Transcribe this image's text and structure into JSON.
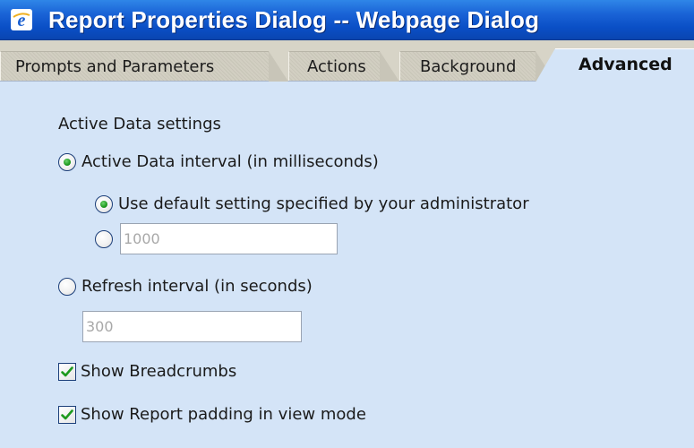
{
  "window": {
    "title": "Report Properties Dialog -- Webpage Dialog",
    "icon": "internet-explorer-icon"
  },
  "tabs": [
    {
      "label": "Prompts and Parameters",
      "active": false
    },
    {
      "label": "Actions",
      "active": false
    },
    {
      "label": "Background",
      "active": false
    },
    {
      "label": "Advanced",
      "active": true
    }
  ],
  "advanced": {
    "section_title": "Active Data settings",
    "active_data_interval": {
      "label": "Active Data interval (in milliseconds)",
      "selected": true
    },
    "use_default": {
      "label": "Use default setting specified by your administrator",
      "selected": true
    },
    "custom_interval": {
      "selected": false,
      "placeholder": "1000"
    },
    "refresh_interval": {
      "label": "Refresh interval (in seconds)",
      "selected": false,
      "placeholder": "300"
    },
    "show_breadcrumbs": {
      "label": "Show Breadcrumbs",
      "checked": true
    },
    "show_report_padding": {
      "label": "Show Report padding in view mode",
      "checked": true
    }
  },
  "colors": {
    "titlebar": "#0a4fc6",
    "content_bg": "#d4e4f7",
    "radio_dot": "#1e9a1e",
    "checkmark": "#1e9a1e"
  }
}
